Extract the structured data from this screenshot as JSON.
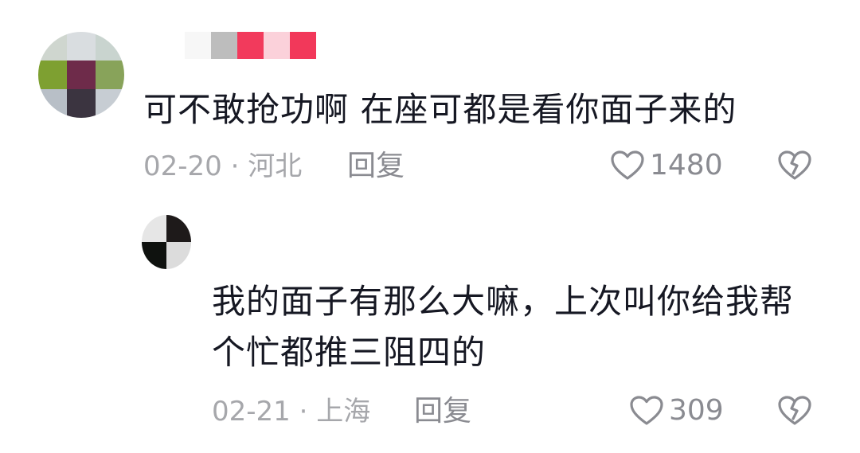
{
  "comments": [
    {
      "text": "可不敢抢功啊  在座可都是看你面子来的",
      "date": "02-20",
      "separator": "·",
      "location": "河北",
      "reply_label": "回复",
      "likes": "1480"
    },
    {
      "text_line1": "我的面子有那么大嘛，上次叫你给我帮",
      "text_line2": "个忙都推三阻四的",
      "date": "02-21",
      "separator": "·",
      "location": "上海",
      "reply_label": "回复",
      "likes": "309"
    }
  ],
  "icons": {
    "like": "heart-outline-icon",
    "dislike": "broken-heart-icon"
  },
  "colors": {
    "text": "#161823",
    "meta": "#a6a7ab",
    "action": "#8a8b91"
  }
}
